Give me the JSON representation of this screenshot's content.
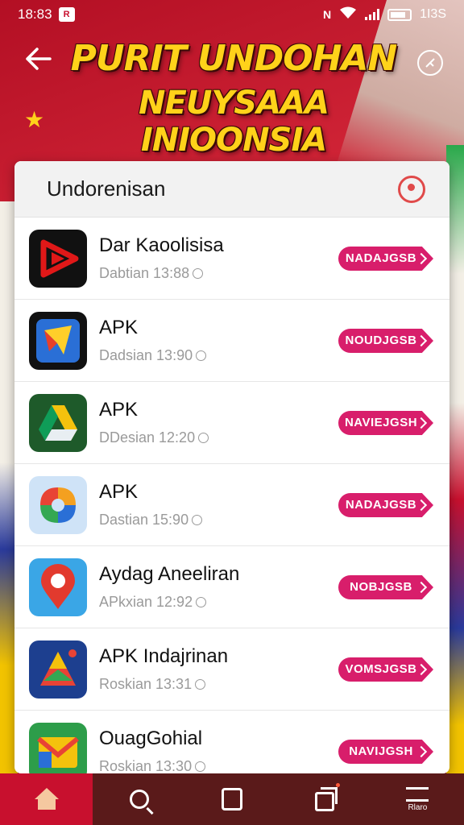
{
  "status_bar": {
    "time": "18:83",
    "badge": "R",
    "right_text": "1I3S"
  },
  "header": {
    "title_line1": "PURIT UNDOHAN",
    "title_line2": "NEUYSAAA INIOONSIA"
  },
  "panel": {
    "title": "Undorenisan"
  },
  "apps": [
    {
      "name": "Dar Kaoolisisa",
      "meta": "Dabtian 13:88",
      "button": "NADAJGSB",
      "icon": "play-icon"
    },
    {
      "name": "APK",
      "meta": "Dadsian 13:90",
      "button": "NOUDJGSB",
      "icon": "paper-plane-icon"
    },
    {
      "name": "APK",
      "meta": "DDesian 12:20",
      "button": "NAVIEJGSH",
      "icon": "drive-icon"
    },
    {
      "name": "APK",
      "meta": "Dastian 15:90",
      "button": "NADAJGSB",
      "icon": "colorful-logo-icon"
    },
    {
      "name": "Aydag Aneeliran",
      "meta": "APkxian 12:92",
      "button": "NOBJGSB",
      "icon": "map-pin-icon"
    },
    {
      "name": "APK Indajrinan",
      "meta": "Roskian 13:31",
      "button": "VOMSJGSB",
      "icon": "triangle-logo-icon"
    },
    {
      "name": "OuagGohial",
      "meta": "Roskian 13:30",
      "button": "NAVIJGSH",
      "icon": "gmail-icon"
    }
  ],
  "bottom_nav": {
    "menu_label": "Rlaro"
  },
  "colors": {
    "brand_red": "#c8102e",
    "title_yellow": "#ffd21a",
    "button_pink": "#d81e6b"
  }
}
